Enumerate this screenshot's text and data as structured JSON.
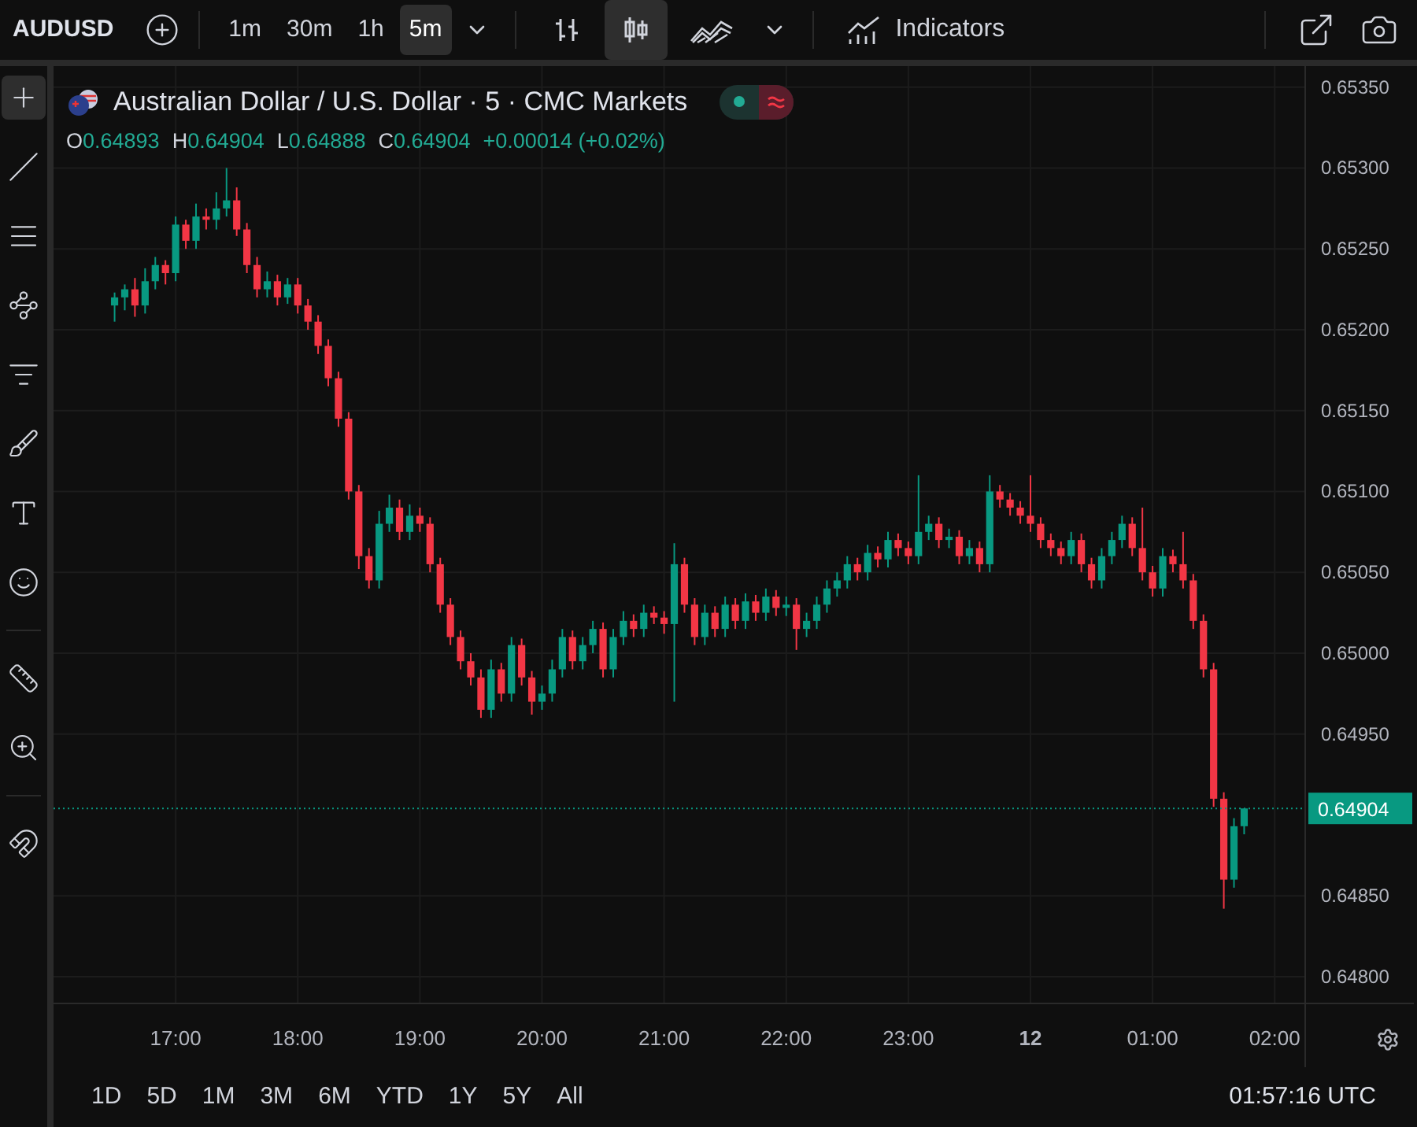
{
  "toolbar": {
    "symbol": "AUDUSD",
    "intervals": [
      {
        "label": "1m",
        "selected": false
      },
      {
        "label": "30m",
        "selected": false
      },
      {
        "label": "1h",
        "selected": false
      },
      {
        "label": "5m",
        "selected": true
      }
    ],
    "chart_types": [
      {
        "kind": "bars",
        "selected": false
      },
      {
        "kind": "candles",
        "selected": true
      },
      {
        "kind": "area",
        "selected": false
      }
    ],
    "indicators_label": "Indicators"
  },
  "legend": {
    "title": "Australian Dollar / U.S. Dollar · 5 · CMC Markets",
    "ohlc": [
      {
        "key": "O",
        "value": "0.64893"
      },
      {
        "key": "H",
        "value": "0.64904"
      },
      {
        "key": "L",
        "value": "0.64888"
      },
      {
        "key": "C",
        "value": "0.64904"
      }
    ],
    "change": "+0.00014 (+0.02%)"
  },
  "chart_data": {
    "type": "candlestick",
    "grid": true,
    "categories": [
      null,
      null,
      null,
      null,
      null,
      null,
      "17:00",
      null,
      null,
      null,
      null,
      null,
      null,
      null,
      null,
      null,
      null,
      null,
      "18:00",
      null,
      null,
      null,
      null,
      null,
      null,
      null,
      null,
      null,
      null,
      null,
      "19:00",
      null,
      null,
      null,
      null,
      null,
      null,
      null,
      null,
      null,
      null,
      null,
      "20:00",
      null,
      null,
      null,
      null,
      null,
      null,
      null,
      null,
      null,
      null,
      null,
      "21:00",
      null,
      null,
      null,
      null,
      null,
      null,
      null,
      null,
      null,
      null,
      null,
      "22:00",
      null,
      null,
      null,
      null,
      null,
      null,
      null,
      null,
      null,
      null,
      null,
      "23:00",
      null,
      null,
      null,
      null,
      null,
      null,
      null,
      null,
      null,
      null,
      null,
      "12",
      null,
      null,
      null,
      null,
      null,
      null,
      null,
      null,
      null,
      null,
      null,
      "01:00",
      null,
      null,
      null,
      null,
      null,
      null,
      null,
      null,
      null,
      null,
      null,
      "02:00"
    ],
    "ohlc": [
      [
        0.65215,
        0.65223,
        0.65205,
        0.6522
      ],
      [
        0.6522,
        0.65228,
        0.65212,
        0.65225
      ],
      [
        0.65225,
        0.65232,
        0.65208,
        0.65215
      ],
      [
        0.65215,
        0.65238,
        0.6521,
        0.6523
      ],
      [
        0.6523,
        0.65245,
        0.65225,
        0.6524
      ],
      [
        0.6524,
        0.65243,
        0.65228,
        0.65235
      ],
      [
        0.65235,
        0.6527,
        0.6523,
        0.65265
      ],
      [
        0.65265,
        0.65268,
        0.6525,
        0.65255
      ],
      [
        0.65255,
        0.65278,
        0.6525,
        0.6527
      ],
      [
        0.6527,
        0.65275,
        0.65262,
        0.65268
      ],
      [
        0.65268,
        0.65285,
        0.65262,
        0.65275
      ],
      [
        0.65275,
        0.653,
        0.6527,
        0.6528
      ],
      [
        0.6528,
        0.65288,
        0.65258,
        0.65262
      ],
      [
        0.65262,
        0.65266,
        0.65235,
        0.6524
      ],
      [
        0.6524,
        0.65245,
        0.6522,
        0.65225
      ],
      [
        0.65225,
        0.65236,
        0.6522,
        0.6523
      ],
      [
        0.6523,
        0.65234,
        0.65215,
        0.6522
      ],
      [
        0.6522,
        0.65232,
        0.65216,
        0.65228
      ],
      [
        0.65228,
        0.65232,
        0.6521,
        0.65215
      ],
      [
        0.65215,
        0.65219,
        0.652,
        0.65205
      ],
      [
        0.65205,
        0.65209,
        0.65185,
        0.6519
      ],
      [
        0.6519,
        0.65194,
        0.65165,
        0.6517
      ],
      [
        0.6517,
        0.65174,
        0.6514,
        0.65145
      ],
      [
        0.65145,
        0.65149,
        0.65095,
        0.651
      ],
      [
        0.651,
        0.65104,
        0.65052,
        0.6506
      ],
      [
        0.6506,
        0.65065,
        0.6504,
        0.65045
      ],
      [
        0.65045,
        0.65088,
        0.6504,
        0.6508
      ],
      [
        0.6508,
        0.65098,
        0.65075,
        0.6509
      ],
      [
        0.6509,
        0.65095,
        0.6507,
        0.65075
      ],
      [
        0.65075,
        0.65092,
        0.6507,
        0.65085
      ],
      [
        0.65085,
        0.6509,
        0.65075,
        0.6508
      ],
      [
        0.6508,
        0.65084,
        0.6505,
        0.65055
      ],
      [
        0.65055,
        0.65059,
        0.65025,
        0.6503
      ],
      [
        0.6503,
        0.65034,
        0.65005,
        0.6501
      ],
      [
        0.6501,
        0.65014,
        0.6499,
        0.64995
      ],
      [
        0.64995,
        0.65,
        0.6498,
        0.64985
      ],
      [
        0.64985,
        0.6499,
        0.6496,
        0.64965
      ],
      [
        0.64965,
        0.64996,
        0.6496,
        0.6499
      ],
      [
        0.6499,
        0.64994,
        0.6497,
        0.64975
      ],
      [
        0.64975,
        0.6501,
        0.6497,
        0.65005
      ],
      [
        0.65005,
        0.65009,
        0.6498,
        0.64985
      ],
      [
        0.64985,
        0.64989,
        0.64962,
        0.6497
      ],
      [
        0.6497,
        0.6498,
        0.64965,
        0.64975
      ],
      [
        0.64975,
        0.64996,
        0.6497,
        0.6499
      ],
      [
        0.6499,
        0.65015,
        0.64985,
        0.6501
      ],
      [
        0.6501,
        0.65014,
        0.6499,
        0.64995
      ],
      [
        0.64995,
        0.6501,
        0.6499,
        0.65005
      ],
      [
        0.65005,
        0.6502,
        0.65,
        0.65015
      ],
      [
        0.65015,
        0.65019,
        0.64985,
        0.6499
      ],
      [
        0.6499,
        0.65015,
        0.64985,
        0.6501
      ],
      [
        0.6501,
        0.65026,
        0.65005,
        0.6502
      ],
      [
        0.6502,
        0.65024,
        0.6501,
        0.65015
      ],
      [
        0.65015,
        0.6503,
        0.6501,
        0.65025
      ],
      [
        0.65025,
        0.65029,
        0.65018,
        0.65022
      ],
      [
        0.65022,
        0.65026,
        0.65012,
        0.65018
      ],
      [
        0.65018,
        0.65068,
        0.6497,
        0.65055
      ],
      [
        0.65055,
        0.65059,
        0.65025,
        0.6503
      ],
      [
        0.6503,
        0.65034,
        0.65005,
        0.6501
      ],
      [
        0.6501,
        0.6503,
        0.65005,
        0.65025
      ],
      [
        0.65025,
        0.65029,
        0.6501,
        0.65015
      ],
      [
        0.65015,
        0.65035,
        0.6501,
        0.6503
      ],
      [
        0.6503,
        0.65034,
        0.65015,
        0.6502
      ],
      [
        0.6502,
        0.65037,
        0.65015,
        0.65032
      ],
      [
        0.65032,
        0.65036,
        0.6502,
        0.65025
      ],
      [
        0.65025,
        0.6504,
        0.6502,
        0.65035
      ],
      [
        0.65035,
        0.65039,
        0.65023,
        0.65028
      ],
      [
        0.65028,
        0.65035,
        0.65023,
        0.6503
      ],
      [
        0.6503,
        0.65034,
        0.65002,
        0.65015
      ],
      [
        0.65015,
        0.65025,
        0.6501,
        0.6502
      ],
      [
        0.6502,
        0.65035,
        0.65015,
        0.6503
      ],
      [
        0.6503,
        0.65045,
        0.65025,
        0.6504
      ],
      [
        0.6504,
        0.6505,
        0.65035,
        0.65045
      ],
      [
        0.65045,
        0.6506,
        0.6504,
        0.65055
      ],
      [
        0.65055,
        0.65059,
        0.65045,
        0.6505
      ],
      [
        0.6505,
        0.65067,
        0.65045,
        0.65062
      ],
      [
        0.65062,
        0.65066,
        0.65053,
        0.65058
      ],
      [
        0.65058,
        0.65075,
        0.65053,
        0.6507
      ],
      [
        0.6507,
        0.65074,
        0.6506,
        0.65065
      ],
      [
        0.65065,
        0.65069,
        0.65055,
        0.6506
      ],
      [
        0.6506,
        0.6511,
        0.65055,
        0.65075
      ],
      [
        0.65075,
        0.65085,
        0.6507,
        0.6508
      ],
      [
        0.6508,
        0.65084,
        0.65065,
        0.6507
      ],
      [
        0.6507,
        0.65077,
        0.65065,
        0.65072
      ],
      [
        0.65072,
        0.65076,
        0.65055,
        0.6506
      ],
      [
        0.6506,
        0.6507,
        0.65055,
        0.65065
      ],
      [
        0.65065,
        0.65069,
        0.6505,
        0.65055
      ],
      [
        0.65055,
        0.6511,
        0.6505,
        0.651
      ],
      [
        0.651,
        0.65104,
        0.6509,
        0.65095
      ],
      [
        0.65095,
        0.65099,
        0.65085,
        0.6509
      ],
      [
        0.6509,
        0.65094,
        0.6508,
        0.65085
      ],
      [
        0.65085,
        0.6511,
        0.65075,
        0.6508
      ],
      [
        0.6508,
        0.65084,
        0.65065,
        0.6507
      ],
      [
        0.6507,
        0.65074,
        0.6506,
        0.65065
      ],
      [
        0.65065,
        0.65069,
        0.65055,
        0.6506
      ],
      [
        0.6506,
        0.65075,
        0.65055,
        0.6507
      ],
      [
        0.6507,
        0.65074,
        0.6505,
        0.65055
      ],
      [
        0.65055,
        0.65059,
        0.6504,
        0.65045
      ],
      [
        0.65045,
        0.65065,
        0.6504,
        0.6506
      ],
      [
        0.6506,
        0.65075,
        0.65055,
        0.6507
      ],
      [
        0.6507,
        0.65085,
        0.65065,
        0.6508
      ],
      [
        0.6508,
        0.65084,
        0.6506,
        0.65065
      ],
      [
        0.65065,
        0.6509,
        0.65045,
        0.6505
      ],
      [
        0.6505,
        0.65054,
        0.65035,
        0.6504
      ],
      [
        0.6504,
        0.65065,
        0.65035,
        0.6506
      ],
      [
        0.6506,
        0.65064,
        0.6505,
        0.65055
      ],
      [
        0.65055,
        0.65075,
        0.6504,
        0.65045
      ],
      [
        0.65045,
        0.65049,
        0.65015,
        0.6502
      ],
      [
        0.6502,
        0.65024,
        0.64985,
        0.6499
      ],
      [
        0.6499,
        0.64994,
        0.64905,
        0.6491
      ],
      [
        0.6491,
        0.64914,
        0.64842,
        0.6486
      ],
      [
        0.6486,
        0.64898,
        0.64855,
        0.64893
      ],
      [
        0.64893,
        0.64904,
        0.64888,
        0.64904
      ],
      null,
      null,
      null
    ],
    "ylim": [
      0.64744,
      0.65363
    ],
    "ref_lines": [
      {
        "axis": "y",
        "value": 0.64904,
        "label": "0.64904",
        "color": "#089981"
      }
    ],
    "yticks": [
      {
        "value": 0.648,
        "label": "0.64800"
      },
      {
        "value": 0.6485,
        "label": "0.64850"
      },
      {
        "value": 0.6495,
        "label": "0.64950"
      },
      {
        "value": 0.65,
        "label": "0.65000"
      },
      {
        "value": 0.6505,
        "label": "0.65050"
      },
      {
        "value": 0.651,
        "label": "0.65100"
      },
      {
        "value": 0.6515,
        "label": "0.65150"
      },
      {
        "value": 0.652,
        "label": "0.65200"
      },
      {
        "value": 0.6525,
        "label": "0.65250"
      },
      {
        "value": 0.653,
        "label": "0.65300"
      },
      {
        "value": 0.6535,
        "label": "0.65350"
      }
    ]
  },
  "ranges": [
    {
      "label": "1D"
    },
    {
      "label": "5D"
    },
    {
      "label": "1M"
    },
    {
      "label": "3M"
    },
    {
      "label": "6M"
    },
    {
      "label": "YTD"
    },
    {
      "label": "1Y"
    },
    {
      "label": "5Y"
    },
    {
      "label": "All"
    }
  ],
  "clock": "01:57:16 UTC"
}
